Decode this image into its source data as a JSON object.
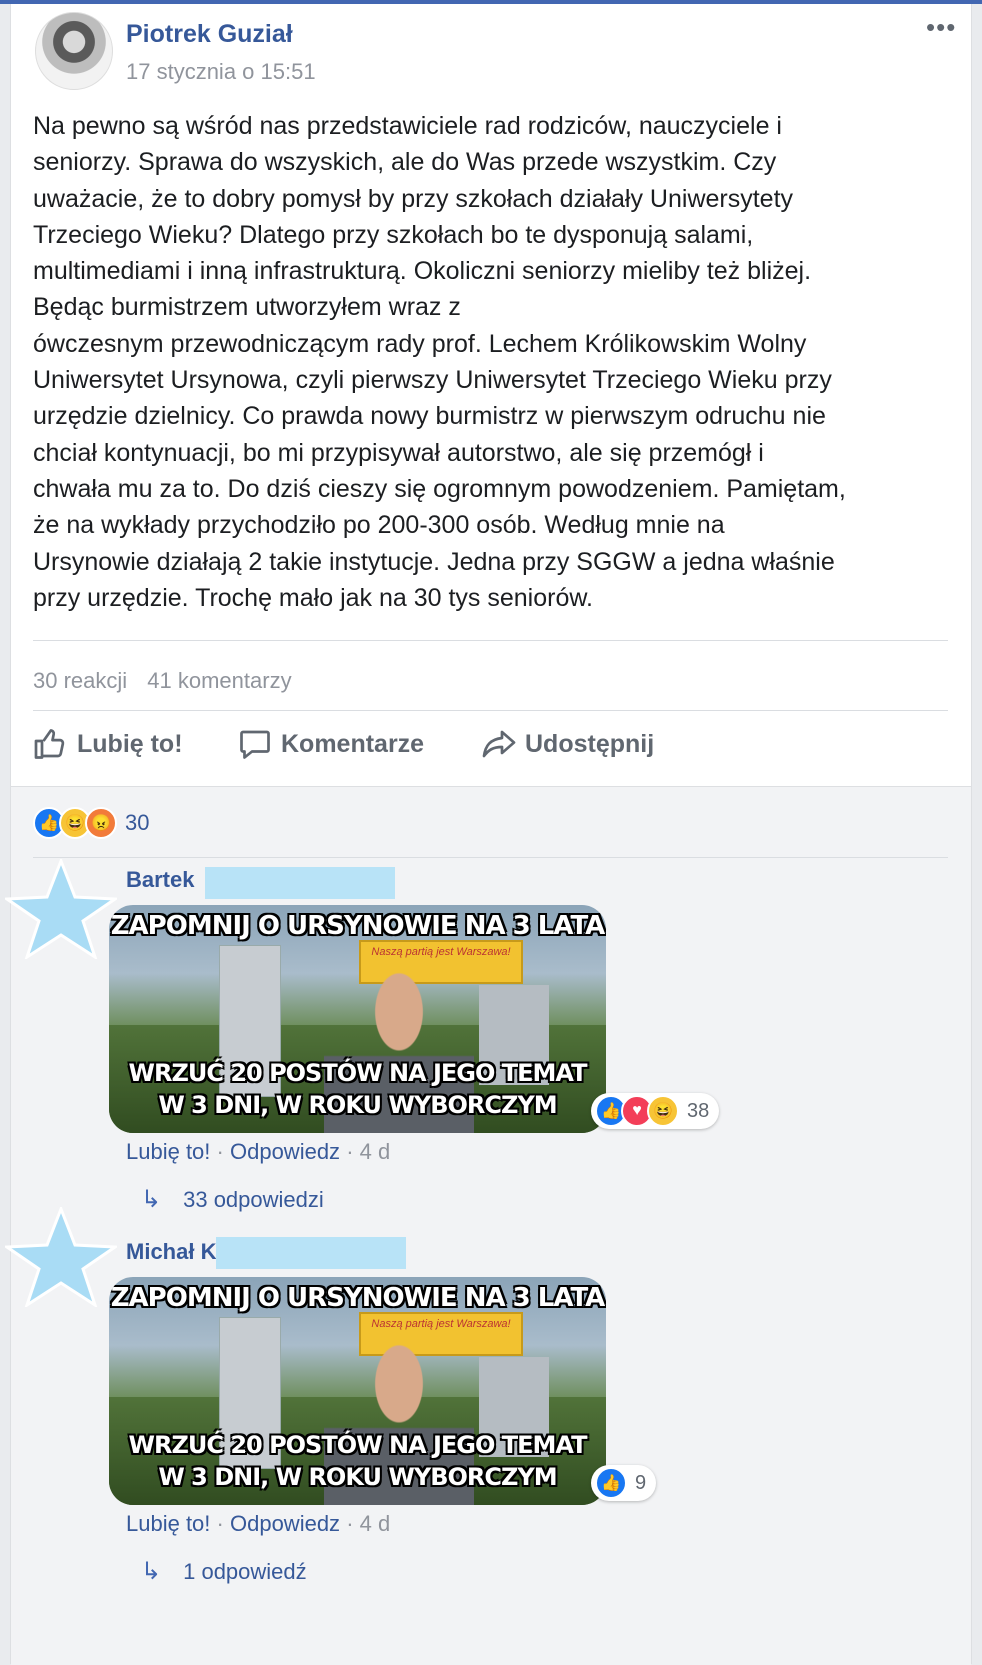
{
  "post": {
    "author": "Piotrek Guział",
    "date": "17 stycznia o 15:51",
    "more": "•••",
    "lines": [
      "Na pewno są wśród nas przedstawiciele rad rodziców, nauczyciele i",
      "seniorzy. Sprawa do wszyskich, ale do Was przede wszystkim. Czy",
      "uważacie, że to dobry pomysł by przy szkołach działały Uniwersytety",
      "Trzeciego Wieku? Dlatego przy szkołach bo te dysponują salami,",
      "multimediami i inną infrastrukturą. Okoliczni seniorzy mieliby też bliżej.",
      "Będąc burmistrzem utworzyłem wraz z",
      "ówczesnym przewodniczącym rady prof. Lechem Królikowskim Wolny",
      "Uniwersytet Ursynowa, czyli pierwszy Uniwersytet Trzeciego Wieku przy",
      "urzędzie dzielnicy. Co prawda nowy burmistrz w pierwszym odruchu nie",
      "chciał kontynuacji, bo mi przypisywał autorstwo, ale się przemógł i",
      "chwała mu za to. Do dziś cieszy się ogromnym powodzeniem. Pamiętam,",
      "że na wykłady przychodziło po 200-300 osób. Według mnie na",
      "Ursynowie działają 2 takie instytucje. Jedna przy SGGW a jedna właśnie",
      "przy urzędzie. Trochę mało jak na 30 tys seniorów."
    ],
    "reactions_count": "30 reakcji",
    "comments_count": "41 komentarzy"
  },
  "actions": {
    "like": "Lubię to!",
    "comment": "Komentarze",
    "share": "Udostępnij"
  },
  "summary": {
    "count": "30"
  },
  "meme": {
    "top": "ZAPOMNIJ O URSYNOWIE NA 3 LATA",
    "bottom1": "WRZUĆ 20 POSTÓW NA JEGO TEMAT",
    "bottom2": "W 3 DNI, W ROKU WYBORCZYM",
    "billboard": "Naszą partią jest Warszawa!"
  },
  "comments": [
    {
      "name": "Bartek",
      "react_count": "38",
      "like": "Lubię to!",
      "reply": "Odpowiedz",
      "age": "4 d",
      "replies": "33 odpowiedzi"
    },
    {
      "name": "Michał K",
      "react_count": "9",
      "like": "Lubię to!",
      "reply": "Odpowiedz",
      "age": "4 d",
      "replies": "1 odpowiedź"
    }
  ],
  "colors": {
    "brand": "#4267b2",
    "link": "#365899",
    "redaction": "#b8e3f7"
  }
}
